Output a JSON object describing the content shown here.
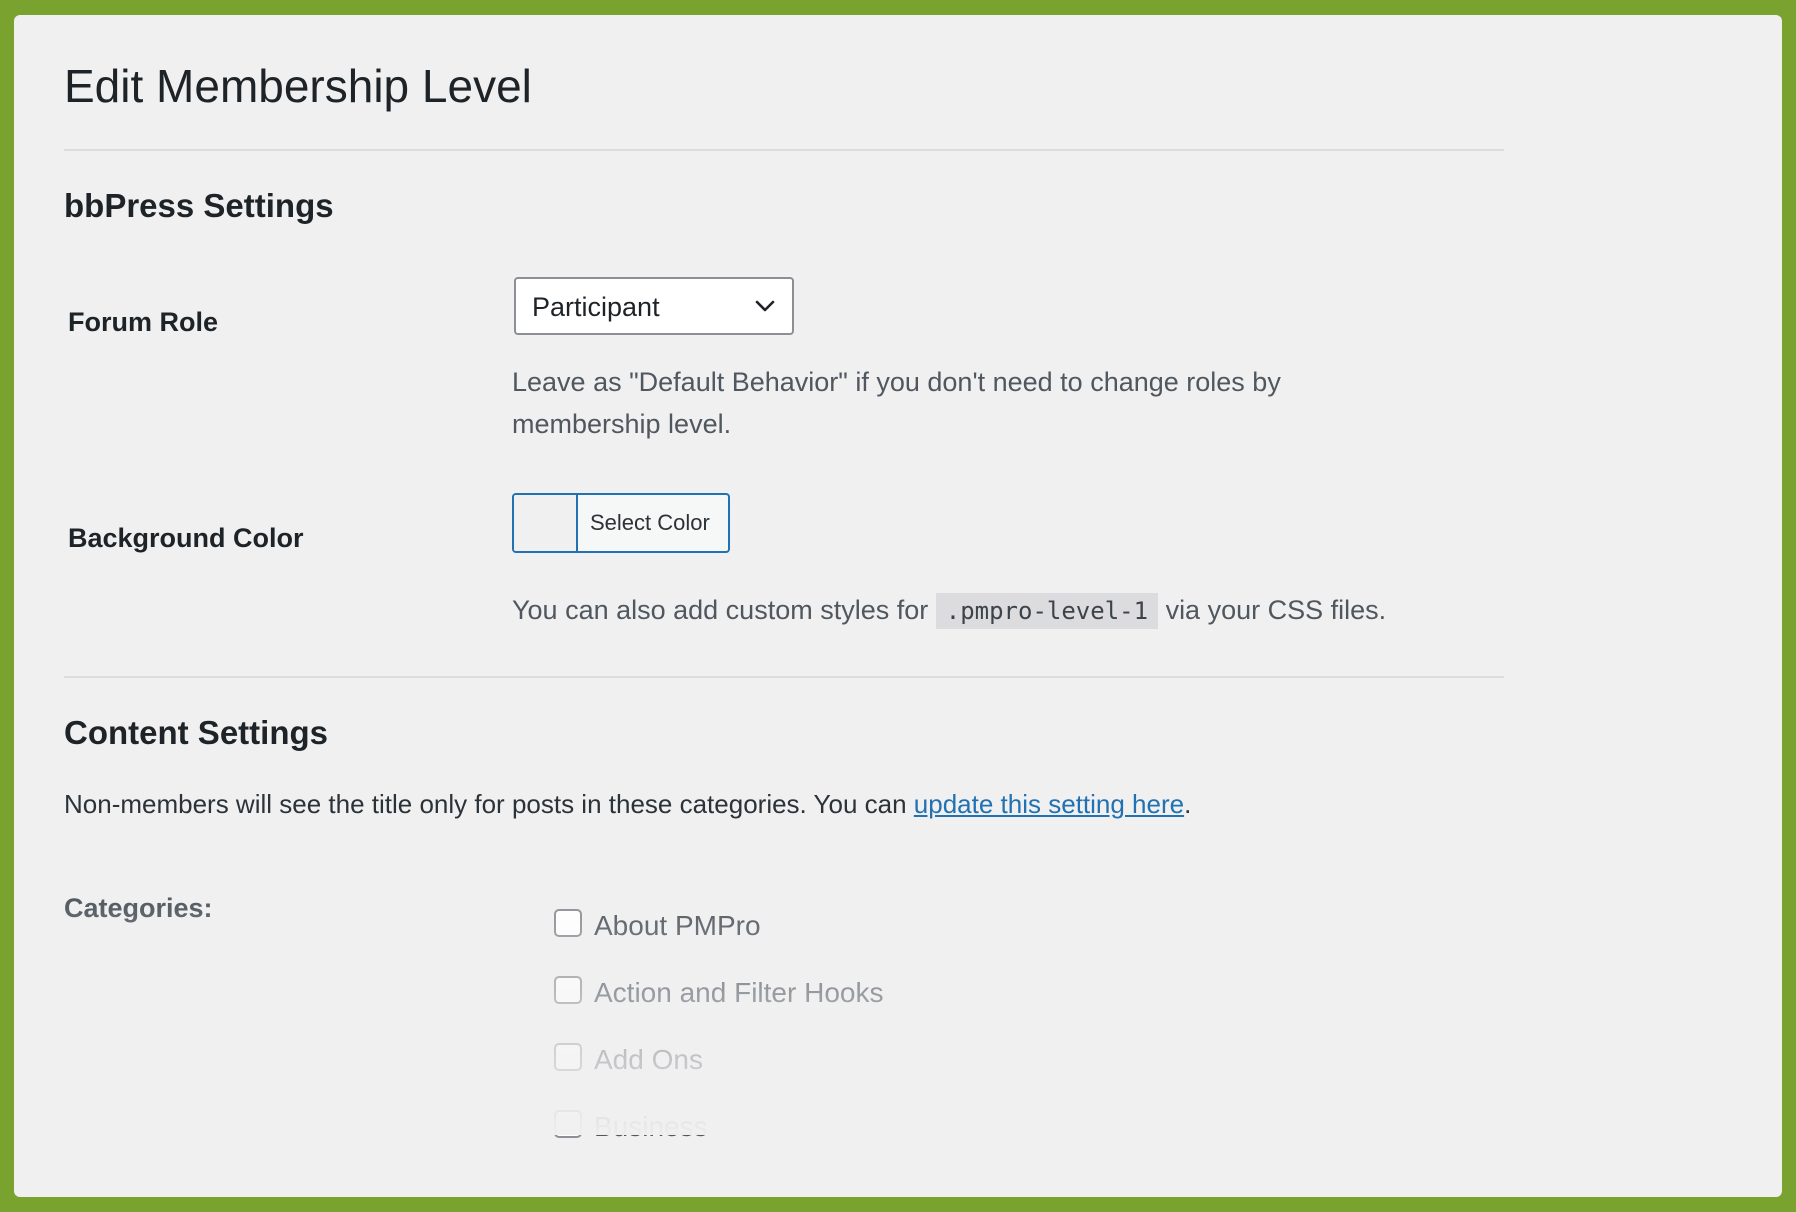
{
  "page": {
    "title": "Edit Membership Level"
  },
  "bbpress": {
    "section_title": "bbPress Settings",
    "forum_role": {
      "label": "Forum Role",
      "selected": "Participant",
      "description_line1": "Leave as \"Default Behavior\" if you don't need to change roles by",
      "description_line2": "membership level."
    },
    "background_color": {
      "label": "Background Color",
      "button_label": "Select Color",
      "swatch_color": "#f0f0f1",
      "description_prefix": "You can also add custom styles for",
      "code": ".pmpro-level-1",
      "description_suffix": "via your CSS files."
    }
  },
  "content": {
    "section_title": "Content Settings",
    "intro_prefix": "Non-members will see the title only for posts in these categories. You can",
    "intro_link": "update this setting here",
    "intro_suffix": ".",
    "categories_label": "Categories:",
    "categories": [
      {
        "label": "About PMPro",
        "checked": false
      },
      {
        "label": "Action and Filter Hooks",
        "checked": false
      },
      {
        "label": "Add Ons",
        "checked": false
      },
      {
        "label": "Business",
        "checked": false
      }
    ]
  },
  "colors": {
    "frame_border": "#7aa22f",
    "panel_background": "#f0f0f1",
    "accent_blue": "#2271b1"
  }
}
